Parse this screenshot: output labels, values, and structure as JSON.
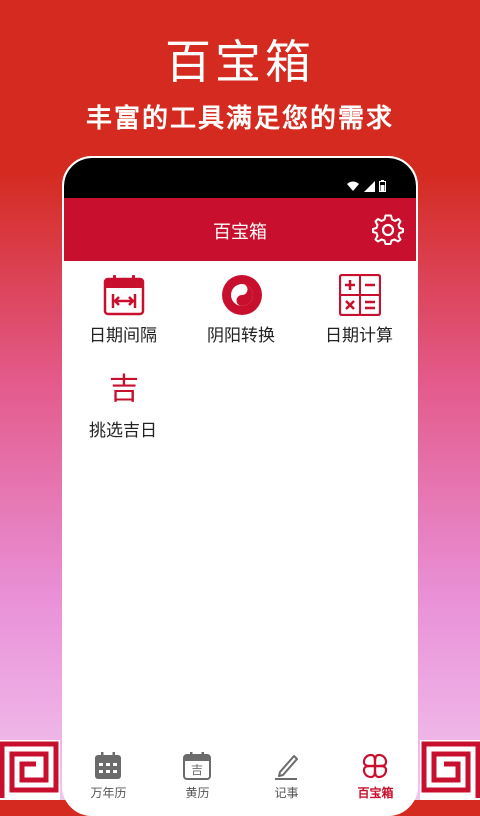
{
  "promo": {
    "title": "百宝箱",
    "subtitle": "丰富的工具满足您的需求"
  },
  "header": {
    "title": "百宝箱"
  },
  "tools": [
    {
      "label": "日期间隔",
      "icon": "calendar-interval-icon"
    },
    {
      "label": "阴阳转换",
      "icon": "yin-yang-icon"
    },
    {
      "label": "日期计算",
      "icon": "calculator-icon"
    },
    {
      "label": "挑选吉日",
      "icon": "auspicious-char-icon",
      "glyph": "吉"
    }
  ],
  "nav": [
    {
      "label": "万年历",
      "icon": "calendar-grid-icon"
    },
    {
      "label": "黄历",
      "icon": "almanac-icon",
      "glyph": "吉"
    },
    {
      "label": "记事",
      "icon": "pen-note-icon"
    },
    {
      "label": "百宝箱",
      "icon": "clover-box-icon",
      "active": true
    }
  ],
  "colors": {
    "brand_red": "#c8102e",
    "promo_red": "#d42a1f",
    "inactive_icon": "#6b6b6b"
  }
}
